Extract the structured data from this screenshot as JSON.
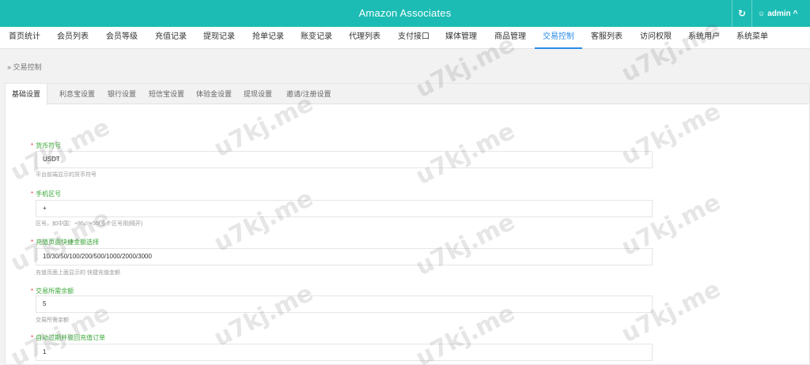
{
  "header": {
    "title": "Amazon Associates",
    "refresh_glyph": "↻",
    "user": {
      "icon": "user-icon",
      "name": "admin",
      "caret": "^"
    }
  },
  "nav": {
    "items": [
      "首页统计",
      "会员列表",
      "会员等级",
      "充值记录",
      "提现记录",
      "抢单记录",
      "账变记录",
      "代理列表",
      "支付接口",
      "媒体管理",
      "商品管理",
      "交易控制",
      "客服列表",
      "访问权限",
      "系统用户",
      "系统菜单"
    ],
    "active": "交易控制"
  },
  "breadcrumb": "» 交易控制",
  "tabs": {
    "items": [
      "基础设置",
      "利息宝设置",
      "银行设置",
      "短信宝设置",
      "体验金设置",
      "提现设置",
      "邀请/注册设置"
    ],
    "active": "基础设置"
  },
  "form": {
    "required_mark": "*",
    "fields": [
      {
        "label": "货币符号",
        "value": "USDT",
        "help": "平台前端显示的货币符号"
      },
      {
        "label": "手机区号",
        "value": "+",
        "help": "区号，如中国：+86，+55(多个区号用|隔开)"
      },
      {
        "label": "充值页面快捷金额选择",
        "value": "10/30/50/100/200/500/1000/2000/3000",
        "help": "充值页面上面显示的 快捷充值金额"
      },
      {
        "label": "交易所需余额",
        "value": "5",
        "help": "交易所需余额"
      },
      {
        "label": "自动过期并驳回充值订单",
        "value": "1",
        "help": ""
      }
    ]
  },
  "watermark": "u7kj.me",
  "colors": {
    "header": "#1cbcb4",
    "accent": "#2a8ce8",
    "label": "#3aa637",
    "required": "#ee3333"
  }
}
